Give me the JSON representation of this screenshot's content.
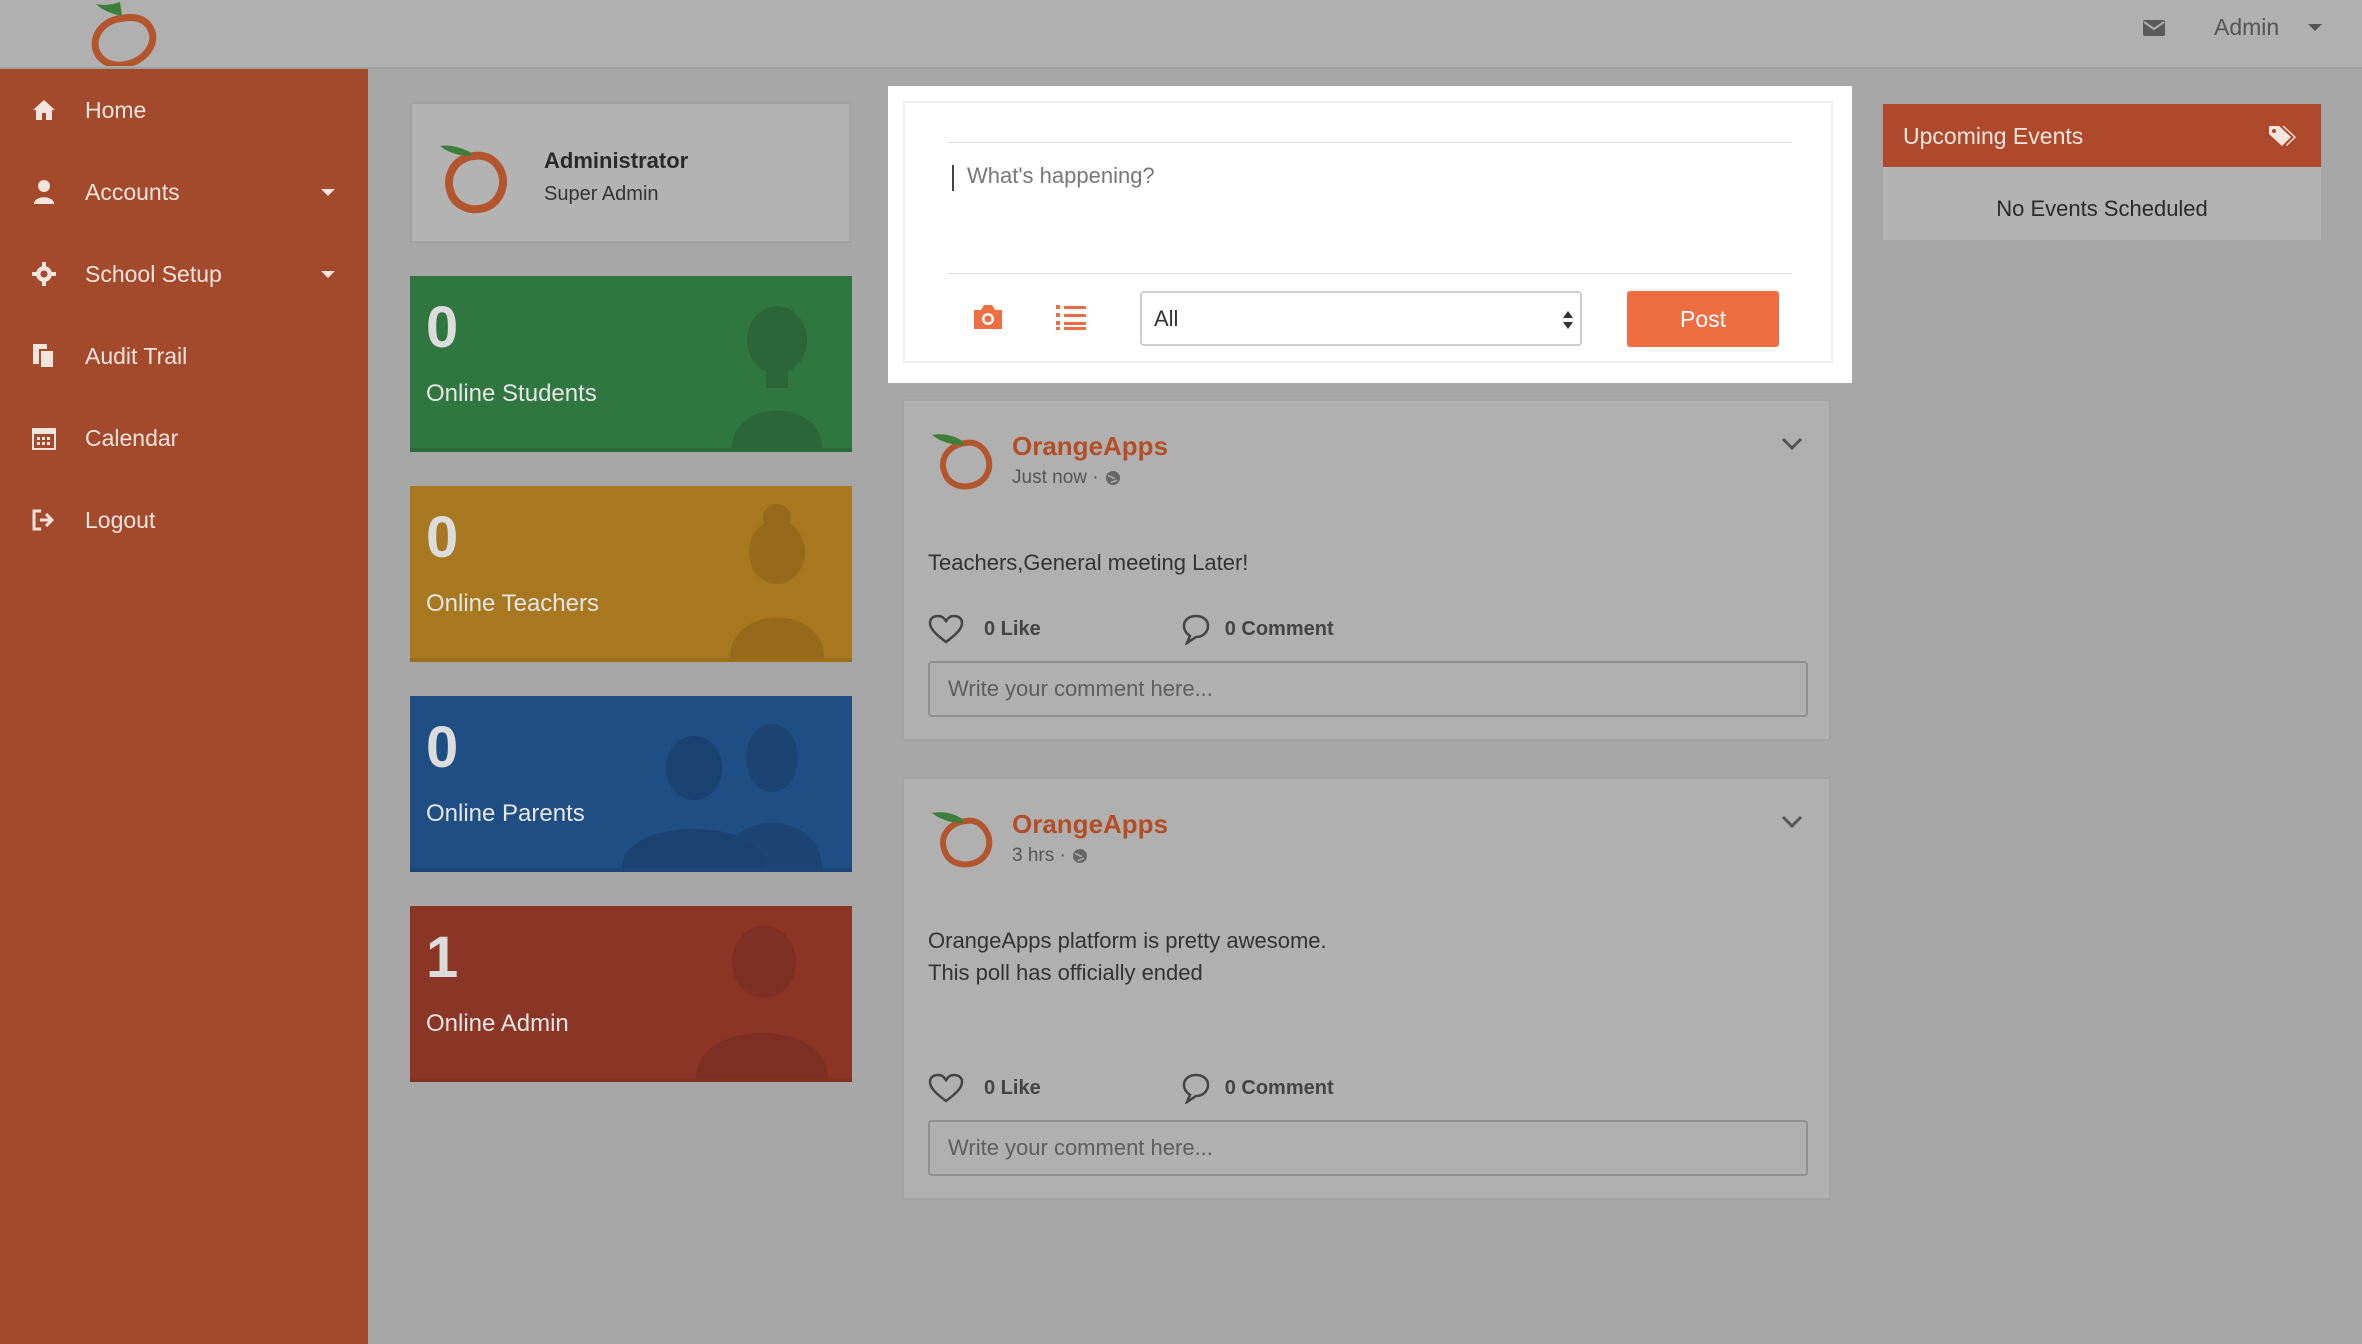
{
  "header": {
    "user_label": "Admin",
    "icons": [
      "logo-icon",
      "mail-icon",
      "chevron-down-icon"
    ]
  },
  "sidebar": {
    "items": [
      {
        "label": "Home",
        "icon": "home-icon"
      },
      {
        "label": "Accounts",
        "icon": "user-icon",
        "has_submenu": true
      },
      {
        "label": "School Setup",
        "icon": "gear-icon",
        "has_submenu": true
      },
      {
        "label": "Audit Trail",
        "icon": "documents-icon"
      },
      {
        "label": "Calendar",
        "icon": "calendar-icon"
      },
      {
        "label": "Logout",
        "icon": "logout-icon"
      }
    ]
  },
  "profile": {
    "name": "Administrator",
    "role": "Super Admin"
  },
  "stats": {
    "students": {
      "count": "0",
      "label": "Online Students",
      "color": "#2f7640"
    },
    "teachers": {
      "count": "0",
      "label": "Online Teachers",
      "color": "#a7781f"
    },
    "parents": {
      "count": "0",
      "label": "Online Parents",
      "color": "#1e4e83"
    },
    "admin": {
      "count": "1",
      "label": "Online Admin",
      "color": "#8b3526"
    }
  },
  "composer": {
    "placeholder": "What's happening?",
    "audience_selected": "All",
    "post_label": "Post"
  },
  "posts": [
    {
      "author": "OrangeApps",
      "time": "Just now ·",
      "lines": [
        "Teachers,General meeting Later!"
      ],
      "likes": "0 Like",
      "comments": "0 Comment",
      "comment_placeholder": "Write your comment here..."
    },
    {
      "author": "OrangeApps",
      "time": "3 hrs ·",
      "lines": [
        "OrangeApps platform is pretty awesome.",
        "This poll has officially ended"
      ],
      "likes": "0 Like",
      "comments": "0 Comment",
      "comment_placeholder": "Write your comment here..."
    }
  ],
  "events": {
    "title": "Upcoming Events",
    "empty_text": "No Events Scheduled"
  },
  "theme": {
    "accent": "#ef6d42",
    "sidebar_bg": "#a34a2d",
    "brand": "#b34e26"
  }
}
